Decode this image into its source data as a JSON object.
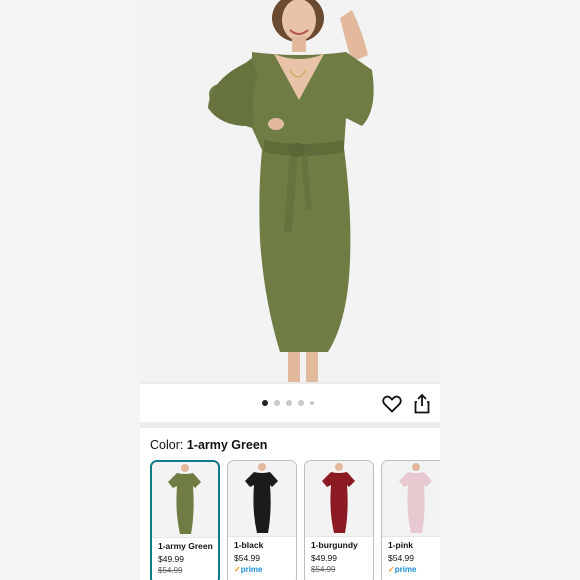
{
  "carousel": {
    "dots": [
      {
        "active": true,
        "size": "normal"
      },
      {
        "active": false,
        "size": "normal"
      },
      {
        "active": false,
        "size": "normal"
      },
      {
        "active": false,
        "size": "normal"
      },
      {
        "active": false,
        "size": "small"
      }
    ],
    "favorite_icon": "heart-outline-icon",
    "share_icon": "share-icon"
  },
  "color_selector": {
    "label": "Color: ",
    "selected": "1-army Green",
    "options": [
      {
        "name": "1-army Green",
        "price": "$49.99",
        "old_price": "$54.99",
        "prime": "",
        "color": "#6f7d45",
        "selected": true
      },
      {
        "name": "1-black",
        "price": "$54.99",
        "old_price": "",
        "prime": "prime",
        "color": "#1b1b1b",
        "selected": false
      },
      {
        "name": "1-burgundy",
        "price": "$49.99",
        "old_price": "$54.99",
        "prime": "",
        "color": "#8c1a22",
        "selected": false
      },
      {
        "name": "1-pink",
        "price": "$54.99",
        "old_price": "",
        "prime": "prime",
        "color": "#e7c9cf",
        "selected": false
      }
    ]
  },
  "colors": {
    "dress": "#6f7d45",
    "selected_border": "#0c7a87",
    "prime_blue": "#1a8fd6"
  }
}
